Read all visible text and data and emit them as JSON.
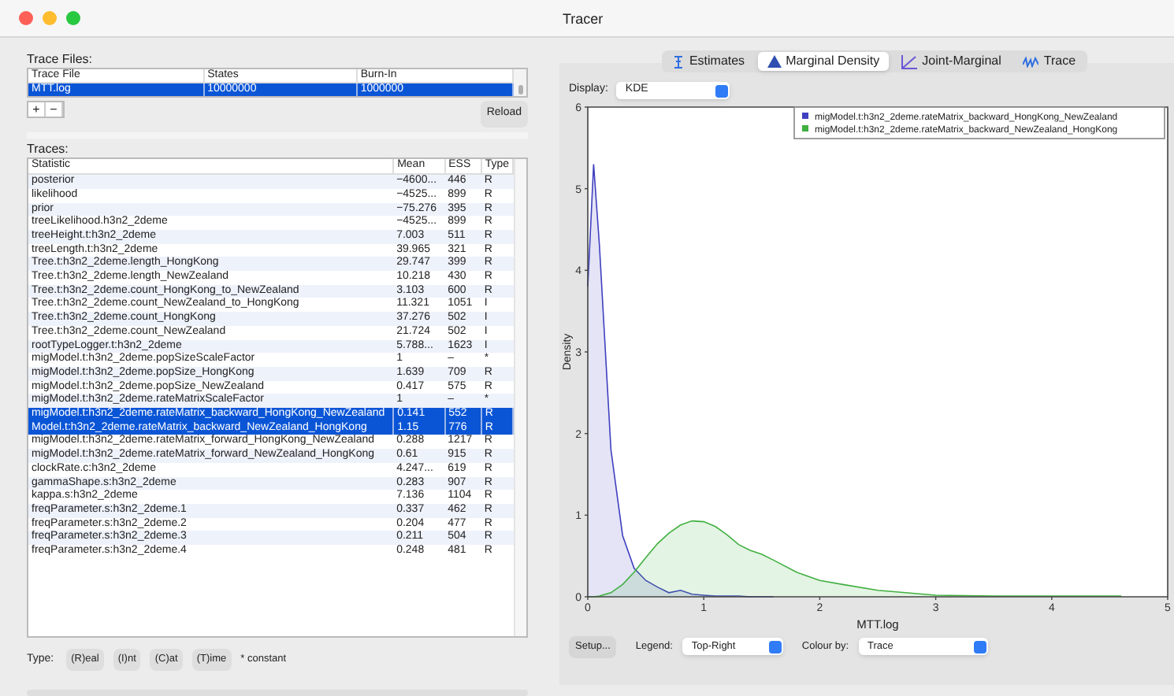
{
  "window": {
    "title": "Tracer"
  },
  "trace_files": {
    "label": "Trace Files:",
    "columns": [
      "Trace File",
      "States",
      "Burn-In"
    ],
    "rows": [
      {
        "cells": [
          "MTT.log",
          "10000000",
          "1000000"
        ],
        "selected": true
      }
    ],
    "buttons": [
      "+",
      "−"
    ],
    "reload": "Reload"
  },
  "traces": {
    "label": "Traces:",
    "columns": [
      "Statistic",
      "Mean",
      "ESS",
      "Type"
    ],
    "rows": [
      {
        "cells": [
          "posterior",
          "−4600...",
          "446",
          "R"
        ],
        "selected": false
      },
      {
        "cells": [
          "likelihood",
          "−4525...",
          "899",
          "R"
        ],
        "selected": false
      },
      {
        "cells": [
          "prior",
          "−75.276",
          "395",
          "R"
        ],
        "selected": false
      },
      {
        "cells": [
          "treeLikelihood.h3n2_2deme",
          "−4525...",
          "899",
          "R"
        ],
        "selected": false
      },
      {
        "cells": [
          "treeHeight.t:h3n2_2deme",
          "7.003",
          "511",
          "R"
        ],
        "selected": false
      },
      {
        "cells": [
          "treeLength.t:h3n2_2deme",
          "39.965",
          "321",
          "R"
        ],
        "selected": false
      },
      {
        "cells": [
          "Tree.t:h3n2_2deme.length_HongKong",
          "29.747",
          "399",
          "R"
        ],
        "selected": false
      },
      {
        "cells": [
          "Tree.t:h3n2_2deme.length_NewZealand",
          "10.218",
          "430",
          "R"
        ],
        "selected": false
      },
      {
        "cells": [
          "Tree.t:h3n2_2deme.count_HongKong_to_NewZealand",
          "3.103",
          "600",
          "R"
        ],
        "selected": false
      },
      {
        "cells": [
          "Tree.t:h3n2_2deme.count_NewZealand_to_HongKong",
          "11.321",
          "1051",
          "I"
        ],
        "selected": false
      },
      {
        "cells": [
          "Tree.t:h3n2_2deme.count_HongKong",
          "37.276",
          "502",
          "I"
        ],
        "selected": false
      },
      {
        "cells": [
          "Tree.t:h3n2_2deme.count_NewZealand",
          "21.724",
          "502",
          "I"
        ],
        "selected": false
      },
      {
        "cells": [
          "rootTypeLogger.t:h3n2_2deme",
          "5.788...",
          "1623",
          "I"
        ],
        "selected": false
      },
      {
        "cells": [
          "migModel.t:h3n2_2deme.popSizeScaleFactor",
          "1",
          "–",
          "*"
        ],
        "selected": false
      },
      {
        "cells": [
          "migModel.t:h3n2_2deme.popSize_HongKong",
          "1.639",
          "709",
          "R"
        ],
        "selected": false
      },
      {
        "cells": [
          "migModel.t:h3n2_2deme.popSize_NewZealand",
          "0.417",
          "575",
          "R"
        ],
        "selected": false
      },
      {
        "cells": [
          "migModel.t:h3n2_2deme.rateMatrixScaleFactor",
          "1",
          "–",
          "*"
        ],
        "selected": false
      },
      {
        "cells": [
          "migModel.t:h3n2_2deme.rateMatrix_backward_HongKong_NewZealand",
          "0.141",
          "552",
          "R"
        ],
        "selected": true
      },
      {
        "cells": [
          "Model.t:h3n2_2deme.rateMatrix_backward_NewZealand_HongKong",
          "1.15",
          "776",
          "R"
        ],
        "selected": true
      },
      {
        "cells": [
          "migModel.t:h3n2_2deme.rateMatrix_forward_HongKong_NewZealand",
          "0.288",
          "1217",
          "R"
        ],
        "selected": false
      },
      {
        "cells": [
          "migModel.t:h3n2_2deme.rateMatrix_forward_NewZealand_HongKong",
          "0.61",
          "915",
          "R"
        ],
        "selected": false
      },
      {
        "cells": [
          "clockRate.c:h3n2_2deme",
          "4.247...",
          "619",
          "R"
        ],
        "selected": false
      },
      {
        "cells": [
          "gammaShape.s:h3n2_2deme",
          "0.283",
          "907",
          "R"
        ],
        "selected": false
      },
      {
        "cells": [
          "kappa.s:h3n2_2deme",
          "7.136",
          "1104",
          "R"
        ],
        "selected": false
      },
      {
        "cells": [
          "freqParameter.s:h3n2_2deme.1",
          "0.337",
          "462",
          "R"
        ],
        "selected": false
      },
      {
        "cells": [
          "freqParameter.s:h3n2_2deme.2",
          "0.204",
          "477",
          "R"
        ],
        "selected": false
      },
      {
        "cells": [
          "freqParameter.s:h3n2_2deme.3",
          "0.211",
          "504",
          "R"
        ],
        "selected": false
      },
      {
        "cells": [
          "freqParameter.s:h3n2_2deme.4",
          "0.248",
          "481",
          "R"
        ],
        "selected": false
      }
    ]
  },
  "type_legend": {
    "label": "Type:",
    "buttons": [
      "(R)eal",
      "(I)nt",
      "(C)at",
      "(T)ime"
    ],
    "note": "* constant"
  },
  "tabs": [
    {
      "label": "Estimates",
      "kind": "estimates",
      "selected": false
    },
    {
      "label": "Marginal Density",
      "kind": "density",
      "selected": true
    },
    {
      "label": "Joint-Marginal",
      "kind": "joint",
      "selected": false
    },
    {
      "label": "Trace",
      "kind": "trace",
      "selected": false
    }
  ],
  "display": {
    "label": "Display:",
    "value": "KDE"
  },
  "chart_data": {
    "type": "area",
    "xlabel": "MTT.log",
    "ylabel": "Density",
    "x": [
      0,
      0.05,
      0.1,
      0.2,
      0.3,
      0.4,
      0.5,
      0.6,
      0.7,
      0.8,
      0.9,
      1.0,
      1.1,
      1.2,
      1.3,
      1.4,
      1.5,
      1.6,
      1.8,
      2.0,
      2.2,
      2.5,
      3.0,
      3.5,
      4.0,
      4.6
    ],
    "series": [
      {
        "name": "migModel.t:h3n2_2deme.rateMatrix_backward_HongKong_NewZealand",
        "color": "#4040c0",
        "values": [
          3.8,
          5.3,
          4.3,
          1.8,
          0.75,
          0.35,
          0.2,
          0.12,
          0.05,
          0.08,
          0.03,
          0.02,
          0.01,
          0.01,
          0.01,
          0,
          0,
          0,
          null,
          null,
          null,
          null,
          null,
          null,
          null,
          null
        ]
      },
      {
        "name": "migModel.t:h3n2_2deme.rateMatrix_backward_NewZealand_HongKong",
        "color": "#40b040",
        "values": [
          0,
          0,
          0.01,
          0.05,
          0.15,
          0.3,
          0.48,
          0.65,
          0.78,
          0.88,
          0.93,
          0.92,
          0.86,
          0.76,
          0.64,
          0.57,
          0.52,
          0.45,
          0.3,
          0.2,
          0.15,
          0.08,
          0.02,
          0.01,
          0.01,
          0.01
        ]
      }
    ],
    "legend": true,
    "xlim": [
      0,
      5
    ],
    "ylim": [
      0,
      6
    ],
    "xticks": [
      0,
      1,
      2,
      3,
      4,
      5
    ],
    "yticks": [
      0,
      1,
      2,
      3,
      4,
      5,
      6
    ]
  },
  "controls": {
    "setup": "Setup...",
    "legend_label": "Legend:",
    "legend_value": "Top-Right",
    "colour_label": "Colour by:",
    "colour_value": "Trace"
  }
}
